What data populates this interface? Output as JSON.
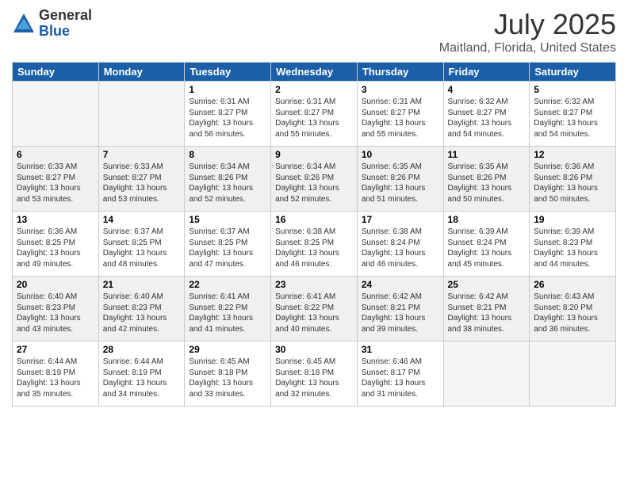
{
  "header": {
    "logo_general": "General",
    "logo_blue": "Blue",
    "title": "July 2025",
    "subtitle": "Maitland, Florida, United States"
  },
  "days_of_week": [
    "Sunday",
    "Monday",
    "Tuesday",
    "Wednesday",
    "Thursday",
    "Friday",
    "Saturday"
  ],
  "weeks": [
    {
      "shaded": false,
      "days": [
        {
          "num": "",
          "info": ""
        },
        {
          "num": "",
          "info": ""
        },
        {
          "num": "1",
          "info": "Sunrise: 6:31 AM\nSunset: 8:27 PM\nDaylight: 13 hours and 56 minutes."
        },
        {
          "num": "2",
          "info": "Sunrise: 6:31 AM\nSunset: 8:27 PM\nDaylight: 13 hours and 55 minutes."
        },
        {
          "num": "3",
          "info": "Sunrise: 6:31 AM\nSunset: 8:27 PM\nDaylight: 13 hours and 55 minutes."
        },
        {
          "num": "4",
          "info": "Sunrise: 6:32 AM\nSunset: 8:27 PM\nDaylight: 13 hours and 54 minutes."
        },
        {
          "num": "5",
          "info": "Sunrise: 6:32 AM\nSunset: 8:27 PM\nDaylight: 13 hours and 54 minutes."
        }
      ]
    },
    {
      "shaded": true,
      "days": [
        {
          "num": "6",
          "info": "Sunrise: 6:33 AM\nSunset: 8:27 PM\nDaylight: 13 hours and 53 minutes."
        },
        {
          "num": "7",
          "info": "Sunrise: 6:33 AM\nSunset: 8:27 PM\nDaylight: 13 hours and 53 minutes."
        },
        {
          "num": "8",
          "info": "Sunrise: 6:34 AM\nSunset: 8:26 PM\nDaylight: 13 hours and 52 minutes."
        },
        {
          "num": "9",
          "info": "Sunrise: 6:34 AM\nSunset: 8:26 PM\nDaylight: 13 hours and 52 minutes."
        },
        {
          "num": "10",
          "info": "Sunrise: 6:35 AM\nSunset: 8:26 PM\nDaylight: 13 hours and 51 minutes."
        },
        {
          "num": "11",
          "info": "Sunrise: 6:35 AM\nSunset: 8:26 PM\nDaylight: 13 hours and 50 minutes."
        },
        {
          "num": "12",
          "info": "Sunrise: 6:36 AM\nSunset: 8:26 PM\nDaylight: 13 hours and 50 minutes."
        }
      ]
    },
    {
      "shaded": false,
      "days": [
        {
          "num": "13",
          "info": "Sunrise: 6:36 AM\nSunset: 8:25 PM\nDaylight: 13 hours and 49 minutes."
        },
        {
          "num": "14",
          "info": "Sunrise: 6:37 AM\nSunset: 8:25 PM\nDaylight: 13 hours and 48 minutes."
        },
        {
          "num": "15",
          "info": "Sunrise: 6:37 AM\nSunset: 8:25 PM\nDaylight: 13 hours and 47 minutes."
        },
        {
          "num": "16",
          "info": "Sunrise: 6:38 AM\nSunset: 8:25 PM\nDaylight: 13 hours and 46 minutes."
        },
        {
          "num": "17",
          "info": "Sunrise: 6:38 AM\nSunset: 8:24 PM\nDaylight: 13 hours and 46 minutes."
        },
        {
          "num": "18",
          "info": "Sunrise: 6:39 AM\nSunset: 8:24 PM\nDaylight: 13 hours and 45 minutes."
        },
        {
          "num": "19",
          "info": "Sunrise: 6:39 AM\nSunset: 8:23 PM\nDaylight: 13 hours and 44 minutes."
        }
      ]
    },
    {
      "shaded": true,
      "days": [
        {
          "num": "20",
          "info": "Sunrise: 6:40 AM\nSunset: 8:23 PM\nDaylight: 13 hours and 43 minutes."
        },
        {
          "num": "21",
          "info": "Sunrise: 6:40 AM\nSunset: 8:23 PM\nDaylight: 13 hours and 42 minutes."
        },
        {
          "num": "22",
          "info": "Sunrise: 6:41 AM\nSunset: 8:22 PM\nDaylight: 13 hours and 41 minutes."
        },
        {
          "num": "23",
          "info": "Sunrise: 6:41 AM\nSunset: 8:22 PM\nDaylight: 13 hours and 40 minutes."
        },
        {
          "num": "24",
          "info": "Sunrise: 6:42 AM\nSunset: 8:21 PM\nDaylight: 13 hours and 39 minutes."
        },
        {
          "num": "25",
          "info": "Sunrise: 6:42 AM\nSunset: 8:21 PM\nDaylight: 13 hours and 38 minutes."
        },
        {
          "num": "26",
          "info": "Sunrise: 6:43 AM\nSunset: 8:20 PM\nDaylight: 13 hours and 36 minutes."
        }
      ]
    },
    {
      "shaded": false,
      "days": [
        {
          "num": "27",
          "info": "Sunrise: 6:44 AM\nSunset: 8:19 PM\nDaylight: 13 hours and 35 minutes."
        },
        {
          "num": "28",
          "info": "Sunrise: 6:44 AM\nSunset: 8:19 PM\nDaylight: 13 hours and 34 minutes."
        },
        {
          "num": "29",
          "info": "Sunrise: 6:45 AM\nSunset: 8:18 PM\nDaylight: 13 hours and 33 minutes."
        },
        {
          "num": "30",
          "info": "Sunrise: 6:45 AM\nSunset: 8:18 PM\nDaylight: 13 hours and 32 minutes."
        },
        {
          "num": "31",
          "info": "Sunrise: 6:46 AM\nSunset: 8:17 PM\nDaylight: 13 hours and 31 minutes."
        },
        {
          "num": "",
          "info": ""
        },
        {
          "num": "",
          "info": ""
        }
      ]
    }
  ]
}
